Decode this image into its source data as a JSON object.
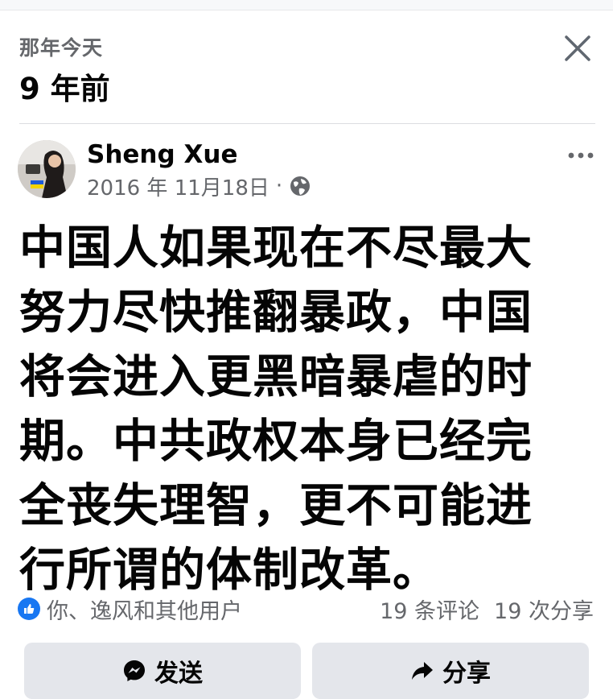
{
  "memory": {
    "label": "那年今天",
    "years_ago": "9 年前"
  },
  "post": {
    "author": "Sheng Xue",
    "date": "2016 年 11月18日",
    "separator": "·",
    "privacy_icon": "globe-icon",
    "text_lines": [
      "中国人如果现在不尽最大",
      "努力尽快推翻暴政，中国",
      "将会进入更黑暗暴虐的时",
      "期。中共政权本身已经完",
      "全丧失理智，更不可能进",
      "行所谓的体制改革。"
    ]
  },
  "engagement": {
    "reactions_text": "你、逸风和其他用户",
    "comments": "19 条评论",
    "shares": "19 次分享"
  },
  "actions": {
    "send_label": "发送",
    "share_label": "分享"
  },
  "colors": {
    "accent": "#1877f2",
    "secondary_text": "#65676b",
    "button_bg": "#e4e6eb"
  }
}
